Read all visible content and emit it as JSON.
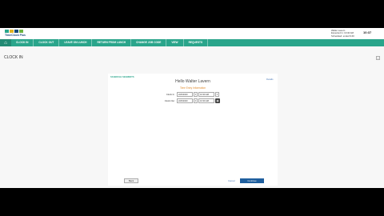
{
  "header": {
    "brand": "TimeClock Plus",
    "logo_colors": [
      "#2aa58b",
      "#e2b321",
      "#1a4c7a",
      "#6cb33f"
    ],
    "user_name": "Walter Lavern",
    "user_line2": "Expected in: 10:40 AM",
    "user_line3": "Scheduled: ended 9:40",
    "time": "10:37"
  },
  "nav": {
    "home_icon": "home-icon",
    "items": [
      "CLOCK IN",
      "CLOCK OUT",
      "LEAVE ON LUNCH",
      "RETURN FROM LUNCH",
      "CHANGE JOB CODE",
      "VIEW",
      "REQUESTS"
    ]
  },
  "page": {
    "title": "CLOCK IN",
    "help": "?"
  },
  "card": {
    "section_label": "SCHEDULE SEGMENTS",
    "link": "Details",
    "greeting": "Hello Walter Lavern",
    "instruction": "Time Entry Information",
    "rows": [
      {
        "label": "Clock In",
        "date": "2/20/2020",
        "time": "10:30 AM"
      },
      {
        "label": "Clock Out",
        "date": "2/20/2020",
        "time": "10:30 AM"
      }
    ],
    "back_label": "Back",
    "cancel_label": "Cancel",
    "continue_label": "Continue"
  }
}
